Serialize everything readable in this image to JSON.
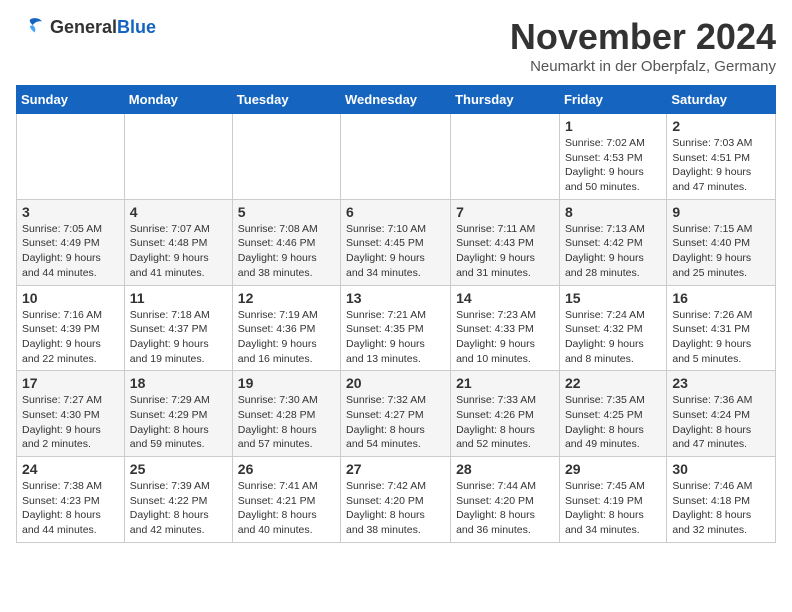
{
  "logo": {
    "general": "General",
    "blue": "Blue"
  },
  "title": "November 2024",
  "subtitle": "Neumarkt in der Oberpfalz, Germany",
  "weekdays": [
    "Sunday",
    "Monday",
    "Tuesday",
    "Wednesday",
    "Thursday",
    "Friday",
    "Saturday"
  ],
  "weeks": [
    [
      {
        "day": "",
        "info": ""
      },
      {
        "day": "",
        "info": ""
      },
      {
        "day": "",
        "info": ""
      },
      {
        "day": "",
        "info": ""
      },
      {
        "day": "",
        "info": ""
      },
      {
        "day": "1",
        "info": "Sunrise: 7:02 AM\nSunset: 4:53 PM\nDaylight: 9 hours\nand 50 minutes."
      },
      {
        "day": "2",
        "info": "Sunrise: 7:03 AM\nSunset: 4:51 PM\nDaylight: 9 hours\nand 47 minutes."
      }
    ],
    [
      {
        "day": "3",
        "info": "Sunrise: 7:05 AM\nSunset: 4:49 PM\nDaylight: 9 hours\nand 44 minutes."
      },
      {
        "day": "4",
        "info": "Sunrise: 7:07 AM\nSunset: 4:48 PM\nDaylight: 9 hours\nand 41 minutes."
      },
      {
        "day": "5",
        "info": "Sunrise: 7:08 AM\nSunset: 4:46 PM\nDaylight: 9 hours\nand 38 minutes."
      },
      {
        "day": "6",
        "info": "Sunrise: 7:10 AM\nSunset: 4:45 PM\nDaylight: 9 hours\nand 34 minutes."
      },
      {
        "day": "7",
        "info": "Sunrise: 7:11 AM\nSunset: 4:43 PM\nDaylight: 9 hours\nand 31 minutes."
      },
      {
        "day": "8",
        "info": "Sunrise: 7:13 AM\nSunset: 4:42 PM\nDaylight: 9 hours\nand 28 minutes."
      },
      {
        "day": "9",
        "info": "Sunrise: 7:15 AM\nSunset: 4:40 PM\nDaylight: 9 hours\nand 25 minutes."
      }
    ],
    [
      {
        "day": "10",
        "info": "Sunrise: 7:16 AM\nSunset: 4:39 PM\nDaylight: 9 hours\nand 22 minutes."
      },
      {
        "day": "11",
        "info": "Sunrise: 7:18 AM\nSunset: 4:37 PM\nDaylight: 9 hours\nand 19 minutes."
      },
      {
        "day": "12",
        "info": "Sunrise: 7:19 AM\nSunset: 4:36 PM\nDaylight: 9 hours\nand 16 minutes."
      },
      {
        "day": "13",
        "info": "Sunrise: 7:21 AM\nSunset: 4:35 PM\nDaylight: 9 hours\nand 13 minutes."
      },
      {
        "day": "14",
        "info": "Sunrise: 7:23 AM\nSunset: 4:33 PM\nDaylight: 9 hours\nand 10 minutes."
      },
      {
        "day": "15",
        "info": "Sunrise: 7:24 AM\nSunset: 4:32 PM\nDaylight: 9 hours\nand 8 minutes."
      },
      {
        "day": "16",
        "info": "Sunrise: 7:26 AM\nSunset: 4:31 PM\nDaylight: 9 hours\nand 5 minutes."
      }
    ],
    [
      {
        "day": "17",
        "info": "Sunrise: 7:27 AM\nSunset: 4:30 PM\nDaylight: 9 hours\nand 2 minutes."
      },
      {
        "day": "18",
        "info": "Sunrise: 7:29 AM\nSunset: 4:29 PM\nDaylight: 8 hours\nand 59 minutes."
      },
      {
        "day": "19",
        "info": "Sunrise: 7:30 AM\nSunset: 4:28 PM\nDaylight: 8 hours\nand 57 minutes."
      },
      {
        "day": "20",
        "info": "Sunrise: 7:32 AM\nSunset: 4:27 PM\nDaylight: 8 hours\nand 54 minutes."
      },
      {
        "day": "21",
        "info": "Sunrise: 7:33 AM\nSunset: 4:26 PM\nDaylight: 8 hours\nand 52 minutes."
      },
      {
        "day": "22",
        "info": "Sunrise: 7:35 AM\nSunset: 4:25 PM\nDaylight: 8 hours\nand 49 minutes."
      },
      {
        "day": "23",
        "info": "Sunrise: 7:36 AM\nSunset: 4:24 PM\nDaylight: 8 hours\nand 47 minutes."
      }
    ],
    [
      {
        "day": "24",
        "info": "Sunrise: 7:38 AM\nSunset: 4:23 PM\nDaylight: 8 hours\nand 44 minutes."
      },
      {
        "day": "25",
        "info": "Sunrise: 7:39 AM\nSunset: 4:22 PM\nDaylight: 8 hours\nand 42 minutes."
      },
      {
        "day": "26",
        "info": "Sunrise: 7:41 AM\nSunset: 4:21 PM\nDaylight: 8 hours\nand 40 minutes."
      },
      {
        "day": "27",
        "info": "Sunrise: 7:42 AM\nSunset: 4:20 PM\nDaylight: 8 hours\nand 38 minutes."
      },
      {
        "day": "28",
        "info": "Sunrise: 7:44 AM\nSunset: 4:20 PM\nDaylight: 8 hours\nand 36 minutes."
      },
      {
        "day": "29",
        "info": "Sunrise: 7:45 AM\nSunset: 4:19 PM\nDaylight: 8 hours\nand 34 minutes."
      },
      {
        "day": "30",
        "info": "Sunrise: 7:46 AM\nSunset: 4:18 PM\nDaylight: 8 hours\nand 32 minutes."
      }
    ]
  ]
}
